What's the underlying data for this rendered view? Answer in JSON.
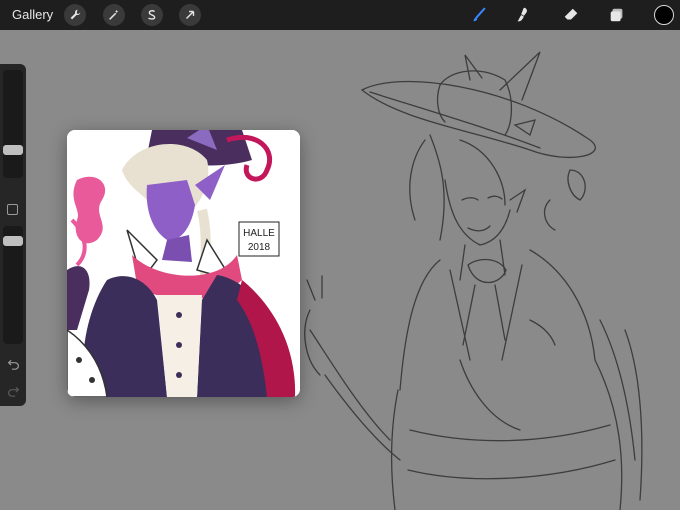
{
  "toolbar": {
    "gallery_label": "Gallery",
    "left_tools": [
      {
        "icon": "wrench-icon",
        "name": "actions"
      },
      {
        "icon": "magic-wand-icon",
        "name": "adjustments"
      },
      {
        "icon": "selection-s-icon",
        "name": "selection"
      },
      {
        "icon": "arrow-cursor-icon",
        "name": "transform"
      }
    ],
    "right_tools": [
      {
        "icon": "brush-icon",
        "name": "brush",
        "active": true
      },
      {
        "icon": "smudge-icon",
        "name": "smudge"
      },
      {
        "icon": "eraser-icon",
        "name": "eraser"
      },
      {
        "icon": "layers-icon",
        "name": "layers"
      }
    ],
    "current_color": "#000000",
    "active_color": "#3a86ff"
  },
  "sidebar": {
    "brush_size_level": 0.55,
    "opacity_level": 0.1,
    "undo_icon": "undo-icon",
    "redo_icon": "redo-icon"
  },
  "reference": {
    "signature_text": "HALLE 2018"
  }
}
